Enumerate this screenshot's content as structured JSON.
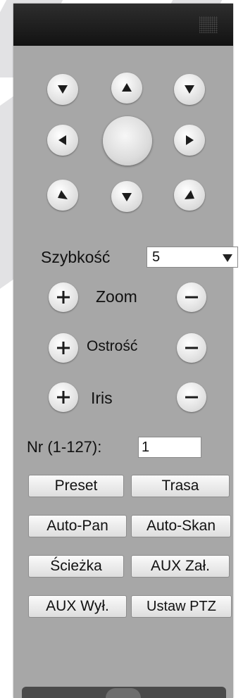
{
  "ptz": {
    "directions": {
      "up_left": "arrow-down-left-icon",
      "up": "arrow-up-icon",
      "up_right": "arrow-down-right-icon",
      "left": "arrow-left-icon",
      "right": "arrow-right-icon",
      "down_left": "arrow-up-left-icon",
      "down": "arrow-down-icon",
      "down_right": "arrow-up-right-icon"
    },
    "speed": {
      "label": "Szybkość",
      "value": "5"
    },
    "controls": [
      {
        "label": "Zoom"
      },
      {
        "label": "Ostrość"
      },
      {
        "label": "Iris"
      }
    ],
    "nr": {
      "label": "Nr (1-127):",
      "value": "1"
    },
    "buttons": {
      "preset": "Preset",
      "tour": "Trasa",
      "auto_pan": "Auto-Pan",
      "auto_scan": "Auto-Skan",
      "pattern": "Ścieżka",
      "aux_on": "AUX Zał.",
      "aux_off": "AUX Wył.",
      "setup": "Ustaw PTZ"
    }
  },
  "colors": {
    "panel_bg": "#a7a7a7",
    "header_bg": "#1a1a1a",
    "button_face": "#e6e6e6",
    "glyph": "#1c1c1c"
  }
}
